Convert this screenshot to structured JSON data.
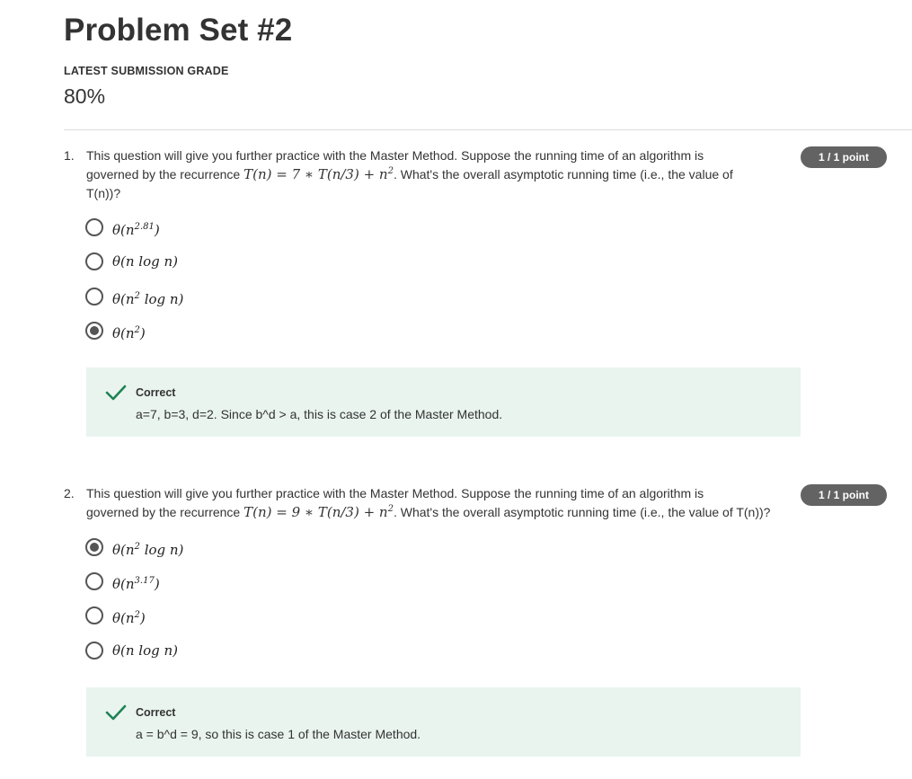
{
  "header": {
    "title": "Problem Set #2",
    "grade_label": "LATEST SUBMISSION GRADE",
    "grade_value": "80%"
  },
  "questions": [
    {
      "number": "1.",
      "text_line1": "This question will give you further practice with the Master Method.  Suppose the running time of an algorithm is",
      "text_line2_pre": "governed by the recurrence ",
      "text_line2_math": "T(n) = 7 ∗ T(n/3) + n",
      "text_line2_math_sup": "2",
      "text_line2_post": ".  What's the overall asymptotic running time (i.e., the value of",
      "text_line3": "T(n))?",
      "points": "1 / 1 point",
      "options": [
        {
          "label": "θ(n",
          "sup": "2.81",
          "tail": ")",
          "selected": false
        },
        {
          "label": "θ(n log n)",
          "sup": "",
          "tail": "",
          "selected": false
        },
        {
          "label": "θ(n",
          "sup": "2",
          "tail": " log n)",
          "selected": false
        },
        {
          "label": "θ(n",
          "sup": "2",
          "tail": ")",
          "selected": true
        }
      ],
      "feedback": {
        "title": "Correct",
        "text": "a=7, b=3, d=2.  Since b^d > a, this is case 2 of the Master Method."
      }
    },
    {
      "number": "2.",
      "text_line1": "This question will give you further practice with the Master Method. Suppose the running time of an algorithm is",
      "text_line2_pre": "governed by the recurrence ",
      "text_line2_math": "T(n) = 9 ∗ T(n/3) + n",
      "text_line2_math_sup": "2",
      "text_line2_post": ". What's the overall asymptotic running time (i.e., the value of T(n))?",
      "text_line3": "",
      "points": "1 / 1 point",
      "options": [
        {
          "label": "θ(n",
          "sup": "2",
          "tail": " log n)",
          "selected": true
        },
        {
          "label": "θ(n",
          "sup": "3.17",
          "tail": ")",
          "selected": false
        },
        {
          "label": "θ(n",
          "sup": "2",
          "tail": ")",
          "selected": false
        },
        {
          "label": "θ(n log n)",
          "sup": "",
          "tail": "",
          "selected": false
        }
      ],
      "feedback": {
        "title": "Correct",
        "text": "a = b^d = 9, so this is case 1 of the Master Method."
      }
    }
  ],
  "colors": {
    "badge_bg": "#636363",
    "feedback_bg": "#e9f4ef",
    "check_green": "#1f8354",
    "radio": "#555555"
  }
}
